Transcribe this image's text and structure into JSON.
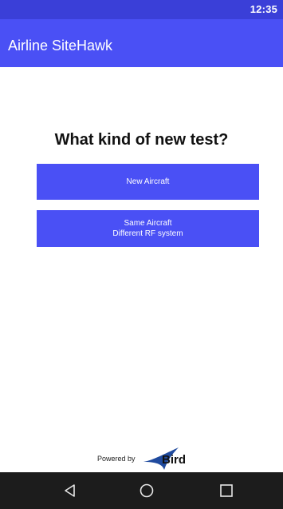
{
  "status_bar": {
    "time": "12:35"
  },
  "app_bar": {
    "title": "Airline SiteHawk"
  },
  "main": {
    "question": "What kind of new test?",
    "buttons": [
      {
        "line1": "New Aircraft",
        "line2": ""
      },
      {
        "line1": "Same Aircraft",
        "line2": "Different RF system"
      }
    ]
  },
  "footer": {
    "powered_by": "Powered by",
    "brand": "Bird"
  },
  "nav_bar": {
    "icons": [
      "back-icon",
      "home-icon",
      "recents-icon"
    ]
  },
  "colors": {
    "status_bar": "#3a3fd8",
    "app_bar": "#4a50f5",
    "button": "#4a50f5",
    "nav_bar": "#1c1c1c",
    "logo_blue": "#1f4a9e"
  }
}
